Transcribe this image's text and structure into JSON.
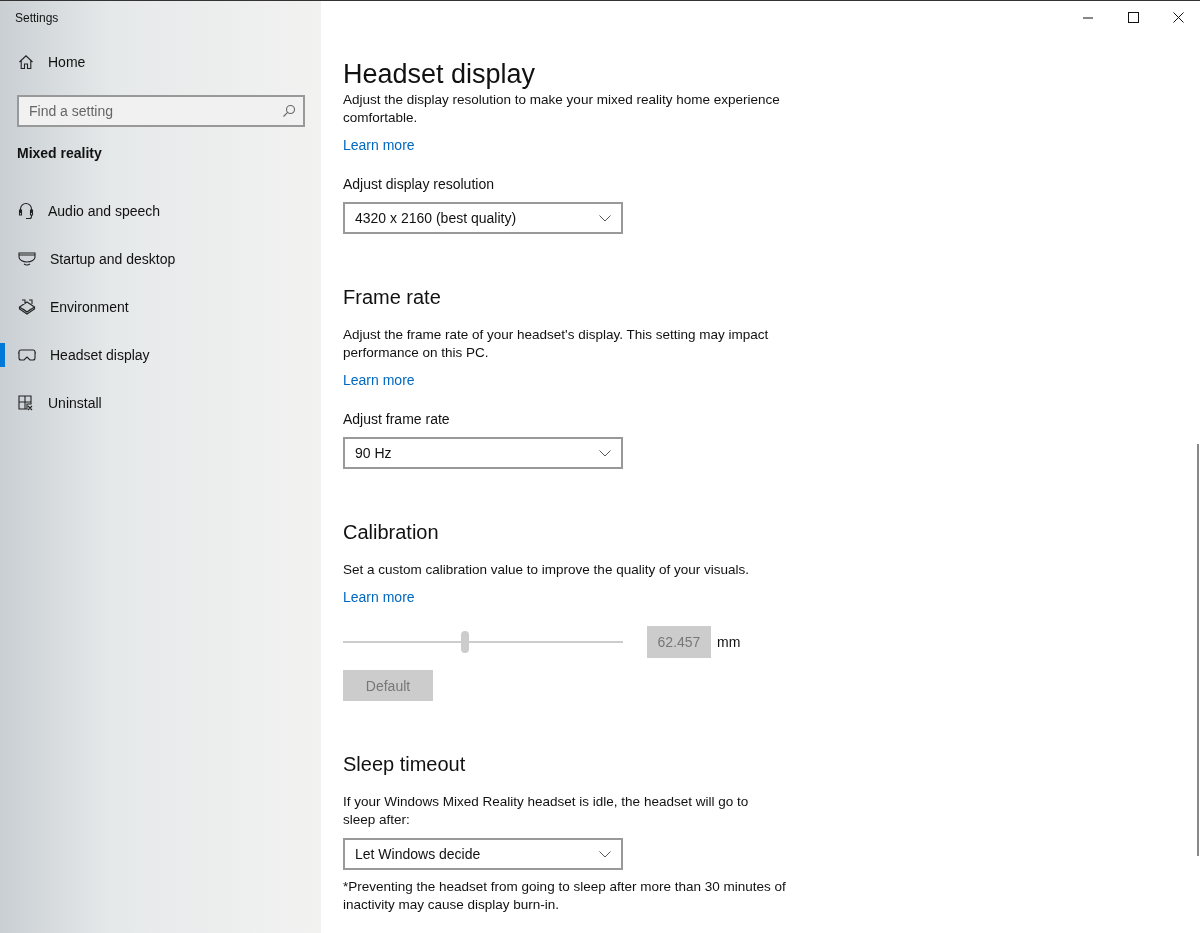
{
  "window": {
    "title": "Settings"
  },
  "sidebar": {
    "home": "Home",
    "search": {
      "placeholder": "Find a setting"
    },
    "section_title": "Mixed reality",
    "items": [
      {
        "label": "Audio and speech",
        "selected": false
      },
      {
        "label": "Startup and desktop",
        "selected": false
      },
      {
        "label": "Environment",
        "selected": false
      },
      {
        "label": "Headset display",
        "selected": true
      },
      {
        "label": "Uninstall",
        "selected": false
      }
    ]
  },
  "page_title": "Headset display",
  "sections": [
    {
      "description": "Adjust the display resolution to make your mixed reality home experience comfortable.",
      "link": "Learn more",
      "controls": [
        {
          "kind": "label",
          "text": "Adjust display resolution"
        },
        {
          "kind": "dropdown",
          "value": "4320 x 2160 (best quality)"
        }
      ]
    },
    {
      "heading": "Frame rate",
      "description": "Adjust the frame rate of your headset's display. This setting may impact performance on this PC.",
      "link": "Learn more",
      "controls": [
        {
          "kind": "label",
          "text": "Adjust frame rate"
        },
        {
          "kind": "dropdown",
          "value": "90 Hz"
        }
      ]
    },
    {
      "heading": "Calibration",
      "description": "Set a custom calibration value to improve the quality of your visuals.",
      "link": "Learn more",
      "controls": [
        {
          "kind": "slider",
          "level": 0.436,
          "value": "62.457",
          "unit": "mm",
          "disabled": true
        },
        {
          "kind": "button",
          "label": "Default",
          "disabled": true
        }
      ]
    },
    {
      "heading": "Sleep timeout",
      "description": "If your Windows Mixed Reality headset is idle, the headset will go to sleep after:",
      "controls": [
        {
          "kind": "dropdown",
          "value": "Let Windows decide"
        },
        {
          "kind": "note",
          "text": "*Preventing the headset from going to sleep after more than 30 minutes of inactivity may cause display burn-in."
        }
      ]
    }
  ]
}
